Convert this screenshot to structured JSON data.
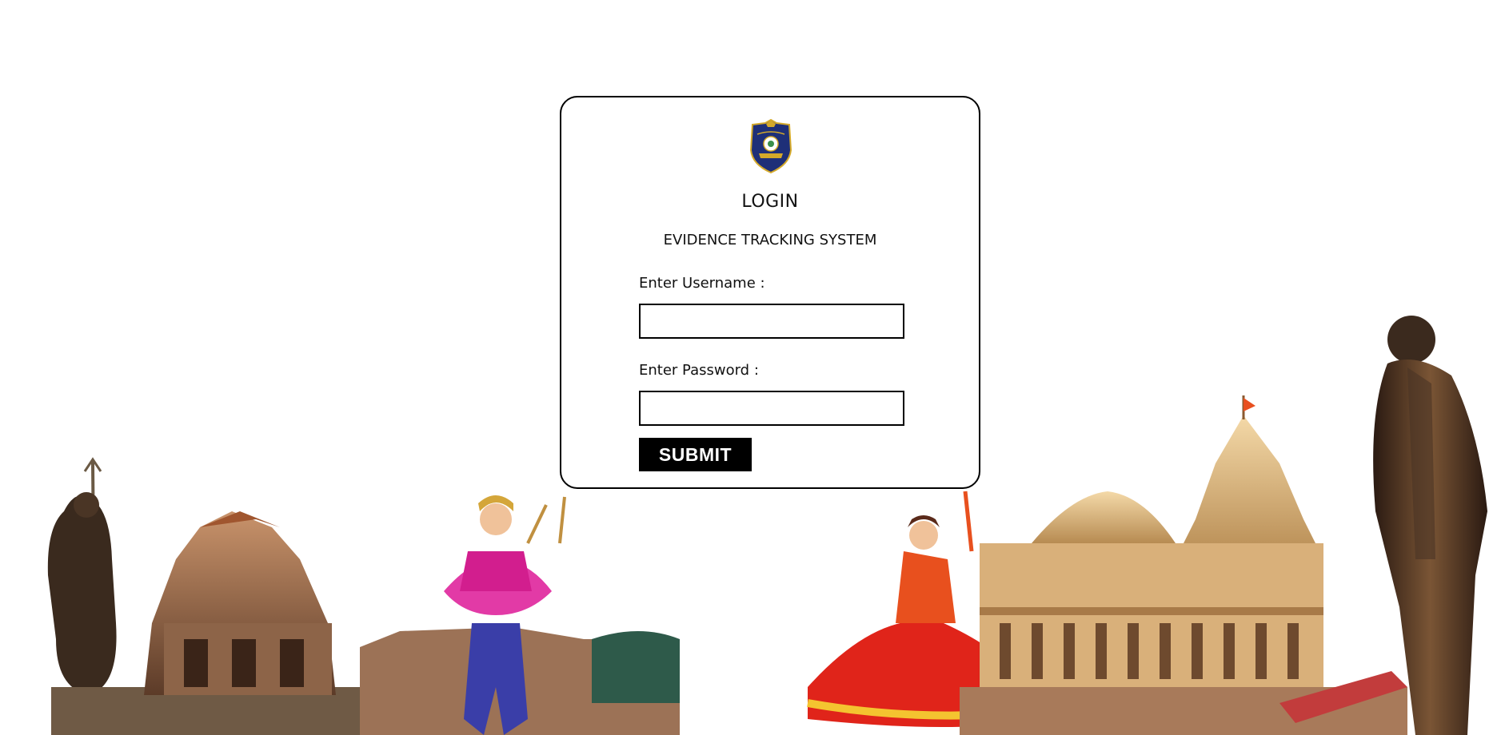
{
  "login": {
    "title": "LOGIN",
    "subtitle": "EVIDENCE TRACKING SYSTEM",
    "username_label": "Enter Username :",
    "username_value": "",
    "password_label": "Enter Password :",
    "password_value": "",
    "submit_label": "SUBMIT"
  },
  "emblem": {
    "icon": "gujarat-police-emblem"
  },
  "colors": {
    "background": "#ffffff",
    "card_border": "#000000",
    "button_bg": "#000000",
    "button_text": "#ffffff",
    "emblem_blue": "#1e2f78",
    "emblem_gold": "#d4a92a"
  }
}
